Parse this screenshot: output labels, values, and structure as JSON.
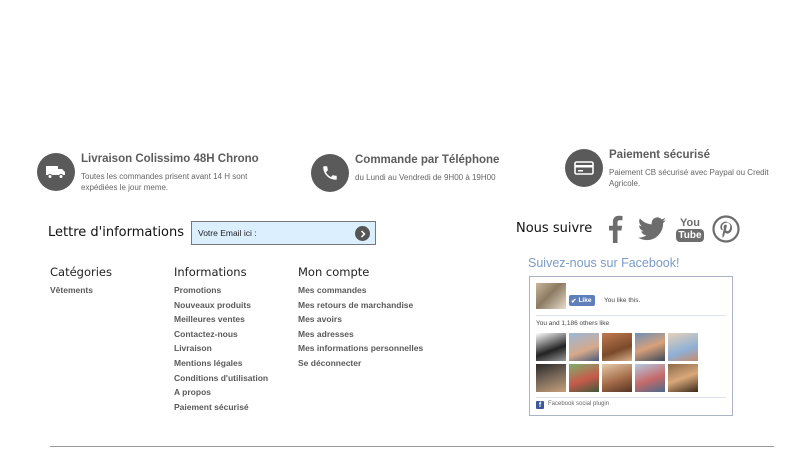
{
  "features": [
    {
      "title": "Livraison Colissimo 48H Chrono",
      "desc": "Toutes les commandes prisent avant 14 H sont expédiées le jour meme.",
      "icon": "truck-icon"
    },
    {
      "title": "Commande par Téléphone",
      "desc": "du Lundi au Vendredi de 9H00 à 19H00",
      "icon": "phone-icon"
    },
    {
      "title": "Paiement sécurisé",
      "desc": "Paiement CB sécurisé avec Paypal ou Credit Agricole.",
      "icon": "credit-card-icon"
    }
  ],
  "newsletter": {
    "title": "Lettre d'informations",
    "placeholder": "Votre Email ici :",
    "submit_icon": "chevron-right-icon"
  },
  "columns": {
    "categories": {
      "title": "Catégories",
      "links": [
        "Vêtements"
      ]
    },
    "informations": {
      "title": "Informations",
      "links": [
        "Promotions",
        "Nouveaux produits",
        "Meilleures ventes",
        "Contactez-nous",
        "Livraison",
        "Mentions légales",
        "Conditions d'utilisation",
        "A propos",
        "Paiement sécurisé"
      ]
    },
    "account": {
      "title": "Mon compte",
      "links": [
        "Mes commandes",
        "Mes retours de marchandise",
        "Mes avoirs",
        "Mes adresses",
        "Mes informations personnelles",
        "Se déconnecter"
      ]
    }
  },
  "follow": {
    "title": "Nous suivre",
    "networks": [
      "facebook-icon",
      "twitter-icon",
      "youtube-icon",
      "pinterest-icon"
    ],
    "youtube_text": {
      "top": "You",
      "bottom": "Tube"
    }
  },
  "facebook_widget": {
    "heading": "Suivez-nous sur Facebook!",
    "like_label": "Like",
    "you_like": "You like this.",
    "others_like": "You and 1,186 others like",
    "plugin_label": "Facebook social plugin"
  },
  "colors": {
    "icon_circle": "#5a5a5a",
    "facebook_blue": "#5f7fba",
    "facebook_heading": "#7a9bc7",
    "newsletter_bg": "#dcefff"
  }
}
